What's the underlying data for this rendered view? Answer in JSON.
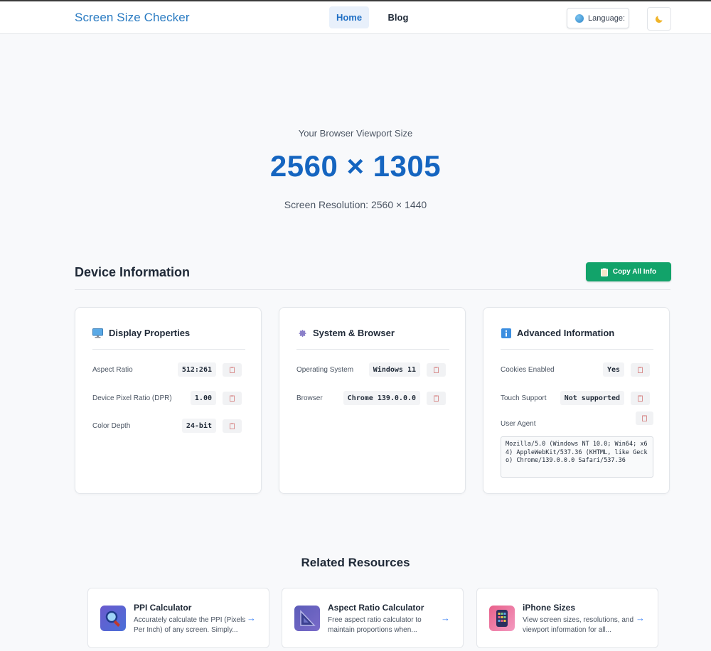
{
  "header": {
    "brand": "Screen Size Checker",
    "nav": {
      "home": "Home",
      "blog": "Blog"
    },
    "language_label": "Language:",
    "theme_icon": "moon-icon"
  },
  "hero": {
    "label": "Your Browser Viewport Size",
    "viewport": "2560 × 1305",
    "resolution": "Screen Resolution: 2560 × 1440"
  },
  "device_info": {
    "title": "Device Information",
    "copy_all_label": "Copy All Info",
    "cards": {
      "display": {
        "title": "Display Properties",
        "icon": "monitor-icon",
        "rows": [
          {
            "label": "Aspect Ratio",
            "value": "512:261"
          },
          {
            "label": "Device Pixel Ratio (DPR)",
            "value": "1.00"
          },
          {
            "label": "Color Depth",
            "value": "24-bit"
          }
        ]
      },
      "system": {
        "title": "System & Browser",
        "icon": "gear-icon",
        "rows": [
          {
            "label": "Operating System",
            "value": "Windows 11"
          },
          {
            "label": "Browser",
            "value": "Chrome 139.0.0.0"
          }
        ]
      },
      "advanced": {
        "title": "Advanced Information",
        "icon": "info-icon",
        "rows": [
          {
            "label": "Cookies Enabled",
            "value": "Yes"
          },
          {
            "label": "Touch Support",
            "value": "Not supported"
          }
        ],
        "user_agent_label": "User Agent",
        "user_agent": "Mozilla/5.0 (Windows NT 10.0; Win64; x64) AppleWebKit/537.36 (KHTML, like Gecko) Chrome/139.0.0.0 Safari/537.36"
      }
    }
  },
  "related": {
    "title": "Related Resources",
    "items": [
      {
        "title": "PPI Calculator",
        "desc": "Accurately calculate the PPI (Pixels Per Inch) of any screen. Simply...",
        "icon": "magnifier-icon"
      },
      {
        "title": "Aspect Ratio Calculator",
        "desc": "Free aspect ratio calculator to maintain proportions when...",
        "icon": "triangle-ruler-icon"
      },
      {
        "title": "iPhone Sizes",
        "desc": "View screen sizes, resolutions, and viewport information for all...",
        "icon": "phone-icon"
      }
    ],
    "arrow": "→"
  }
}
